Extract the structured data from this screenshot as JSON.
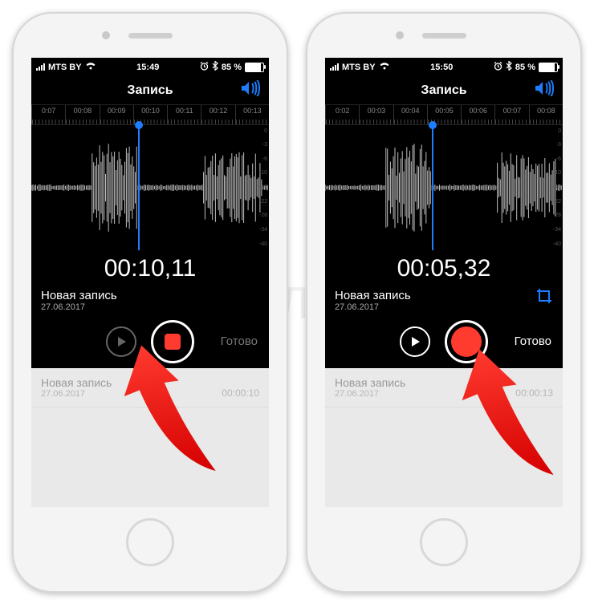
{
  "watermark": "ЯБЛЫК",
  "phones": [
    {
      "status": {
        "carrier": "MTS BY",
        "wifi": true,
        "time": "15:49",
        "alarm": true,
        "bt": true,
        "battery_pct": "85 %"
      },
      "header": {
        "title": "Запись"
      },
      "ruler_ticks": [
        "0:07",
        "00:08",
        "00:09",
        "00:10",
        "00:11",
        "00:12",
        "00:13"
      ],
      "db_labels": [
        "0",
        "-3",
        "-6",
        "-10",
        "-16",
        "-22",
        "-28",
        "-34",
        "-40"
      ],
      "playhead_pct": 45,
      "big_time": "00:10,11",
      "rec_title": "Новая запись",
      "rec_date": "27.06.2017",
      "show_crop": false,
      "play_enabled": false,
      "rec_mode": "stop",
      "done_label": "Готово",
      "done_enabled": false,
      "list": {
        "title": "Новая запись",
        "date": "27.06.2017",
        "duration": "00:00:10"
      },
      "arrow_target": "rec"
    },
    {
      "status": {
        "carrier": "MTS BY",
        "wifi": true,
        "time": "15:50",
        "alarm": true,
        "bt": true,
        "battery_pct": "85 %"
      },
      "header": {
        "title": "Запись"
      },
      "ruler_ticks": [
        "0:02",
        "00:03",
        "00:04",
        "00:05",
        "00:06",
        "00:07",
        "00:08"
      ],
      "db_labels": [
        "0",
        "-3",
        "-6",
        "-10",
        "-16",
        "-22",
        "-28",
        "-34",
        "-40"
      ],
      "playhead_pct": 45,
      "big_time": "00:05,32",
      "rec_title": "Новая запись",
      "rec_date": "27.06.2017",
      "show_crop": true,
      "play_enabled": true,
      "rec_mode": "record",
      "done_label": "Готово",
      "done_enabled": true,
      "list": {
        "title": "Новая запись",
        "date": "27.06.2017",
        "duration": "00:00:13"
      },
      "arrow_target": "done"
    }
  ]
}
